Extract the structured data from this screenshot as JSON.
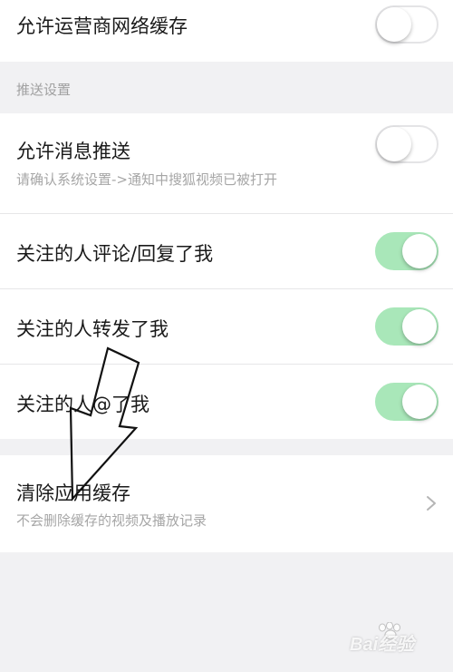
{
  "rows": {
    "carrier_cache": {
      "title": "允许运营商网络缓存",
      "toggle_on": false
    },
    "push_section": {
      "header": "推送设置"
    },
    "allow_push": {
      "title": "允许消息推送",
      "subtitle": "请确认系统设置->通知中搜狐视频已被打开",
      "toggle_on": false
    },
    "comment_reply": {
      "title": "关注的人评论/回复了我",
      "toggle_on": true
    },
    "repost": {
      "title": "关注的人转发了我",
      "toggle_on": true
    },
    "mention": {
      "title": "关注的人@了我",
      "toggle_on": true
    },
    "clear_cache": {
      "title": "清除应用缓存",
      "subtitle": "不会删除缓存的视频及播放记录"
    }
  },
  "colors": {
    "toggle_on": "#a9e7b9",
    "toggle_off_border": "#e4e4e6",
    "background": "#f1f1f3"
  },
  "icons": {
    "chevron": "chevron-right-icon",
    "annotation": "arrow-annotation",
    "watermark": "baidu-jingyan-watermark"
  },
  "watermark": {
    "text": "Bai经验"
  }
}
